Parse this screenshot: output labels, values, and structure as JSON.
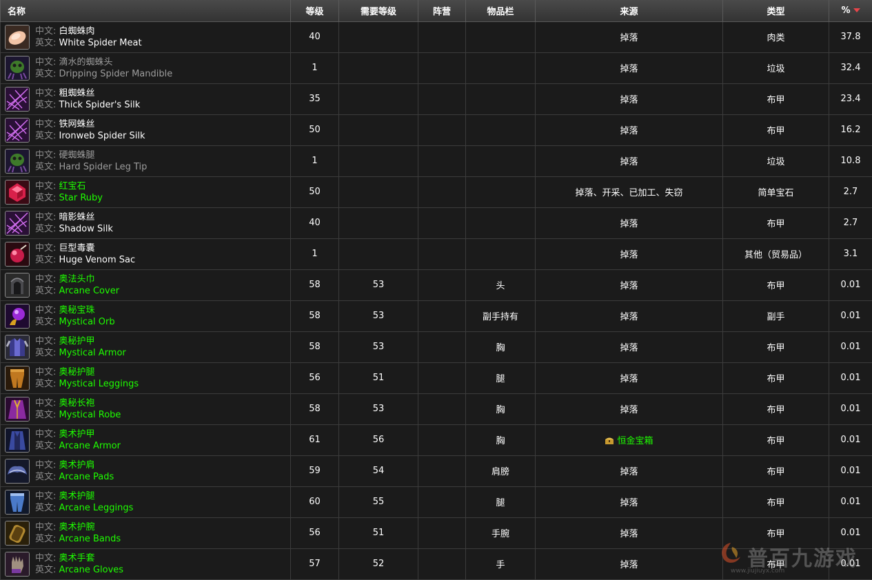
{
  "columns": {
    "name": "名称",
    "level": "等级",
    "req_level": "需要等级",
    "side": "阵营",
    "slot": "物品栏",
    "source": "来源",
    "type": "类型",
    "pct": "%"
  },
  "labels": {
    "cn": "中文:",
    "en": "英文:"
  },
  "rows": [
    {
      "cn": "白蜘蛛肉",
      "en": "White Spider Meat",
      "quality": "white",
      "icon": "meat-icon",
      "level": "40",
      "req": "",
      "side": "",
      "slot": "",
      "source": "掉落",
      "type": "肉类",
      "pct": "37.8"
    },
    {
      "cn": "滴水的蜘蛛头",
      "en": "Dripping Spider Mandible",
      "quality": "gray",
      "icon": "spider-head-icon",
      "level": "1",
      "req": "",
      "side": "",
      "slot": "",
      "source": "掉落",
      "type": "垃圾",
      "pct": "32.4"
    },
    {
      "cn": "粗蜘蛛丝",
      "en": "Thick Spider's Silk",
      "quality": "white",
      "icon": "spider-silk-icon",
      "level": "35",
      "req": "",
      "side": "",
      "slot": "",
      "source": "掉落",
      "type": "布甲",
      "pct": "23.4"
    },
    {
      "cn": "铁网蛛丝",
      "en": "Ironweb Spider Silk",
      "quality": "white",
      "icon": "spider-silk-icon",
      "level": "50",
      "req": "",
      "side": "",
      "slot": "",
      "source": "掉落",
      "type": "布甲",
      "pct": "16.2"
    },
    {
      "cn": "硬蜘蛛腿",
      "en": "Hard Spider Leg Tip",
      "quality": "gray",
      "icon": "spider-head-icon",
      "level": "1",
      "req": "",
      "side": "",
      "slot": "",
      "source": "掉落",
      "type": "垃圾",
      "pct": "10.8"
    },
    {
      "cn": "红宝石",
      "en": "Star Ruby",
      "quality": "green",
      "icon": "ruby-icon",
      "level": "50",
      "req": "",
      "side": "",
      "slot": "",
      "source": "掉落、开采、已加工、失窃",
      "type": "简单宝石",
      "pct": "2.7"
    },
    {
      "cn": "暗影蛛丝",
      "en": "Shadow Silk",
      "quality": "white",
      "icon": "spider-silk-icon",
      "level": "40",
      "req": "",
      "side": "",
      "slot": "",
      "source": "掉落",
      "type": "布甲",
      "pct": "2.7"
    },
    {
      "cn": "巨型毒囊",
      "en": "Huge Venom Sac",
      "quality": "white",
      "icon": "venom-sac-icon",
      "level": "1",
      "req": "",
      "side": "",
      "slot": "",
      "source": "掉落",
      "type": "其他（贸易品）",
      "pct": "3.1"
    },
    {
      "cn": "奥法头巾",
      "en": "Arcane Cover",
      "quality": "green",
      "icon": "hood-icon",
      "level": "58",
      "req": "53",
      "side": "",
      "slot": "头",
      "source": "掉落",
      "type": "布甲",
      "pct": "0.01"
    },
    {
      "cn": "奥秘宝珠",
      "en": "Mystical Orb",
      "quality": "green",
      "icon": "orb-icon",
      "level": "58",
      "req": "53",
      "side": "",
      "slot": "副手持有",
      "source": "掉落",
      "type": "副手",
      "pct": "0.01"
    },
    {
      "cn": "奥秘护甲",
      "en": "Mystical Armor",
      "quality": "green",
      "icon": "chest-armor-icon",
      "level": "58",
      "req": "53",
      "side": "",
      "slot": "胸",
      "source": "掉落",
      "type": "布甲",
      "pct": "0.01"
    },
    {
      "cn": "奥秘护腿",
      "en": "Mystical Leggings",
      "quality": "green",
      "icon": "leggings-icon",
      "level": "56",
      "req": "51",
      "side": "",
      "slot": "腿",
      "source": "掉落",
      "type": "布甲",
      "pct": "0.01"
    },
    {
      "cn": "奥秘长袍",
      "en": "Mystical Robe",
      "quality": "green",
      "icon": "robe-icon",
      "level": "58",
      "req": "53",
      "side": "",
      "slot": "胸",
      "source": "掉落",
      "type": "布甲",
      "pct": "0.01"
    },
    {
      "cn": "奥术护甲",
      "en": "Arcane Armor",
      "quality": "green",
      "icon": "blue-robe-icon",
      "level": "61",
      "req": "56",
      "side": "",
      "slot": "胸",
      "source": "恒金宝箱",
      "source_chest": true,
      "type": "布甲",
      "pct": "0.01"
    },
    {
      "cn": "奥术护肩",
      "en": "Arcane Pads",
      "quality": "green",
      "icon": "shoulder-icon",
      "level": "59",
      "req": "54",
      "side": "",
      "slot": "肩膀",
      "source": "掉落",
      "type": "布甲",
      "pct": "0.01"
    },
    {
      "cn": "奥术护腿",
      "en": "Arcane Leggings",
      "quality": "green",
      "icon": "blue-leggings-icon",
      "level": "60",
      "req": "55",
      "side": "",
      "slot": "腿",
      "source": "掉落",
      "type": "布甲",
      "pct": "0.01"
    },
    {
      "cn": "奥术护腕",
      "en": "Arcane Bands",
      "quality": "green",
      "icon": "bracer-icon",
      "level": "56",
      "req": "51",
      "side": "",
      "slot": "手腕",
      "source": "掉落",
      "type": "布甲",
      "pct": "0.01"
    },
    {
      "cn": "奥术手套",
      "en": "Arcane Gloves",
      "quality": "green",
      "icon": "gloves-icon",
      "level": "57",
      "req": "52",
      "side": "",
      "slot": "手",
      "source": "掉落",
      "type": "布甲",
      "pct": "0.01"
    }
  ],
  "watermark": {
    "text": "普百九游戏",
    "url": "www.jiujiuyx.com"
  }
}
